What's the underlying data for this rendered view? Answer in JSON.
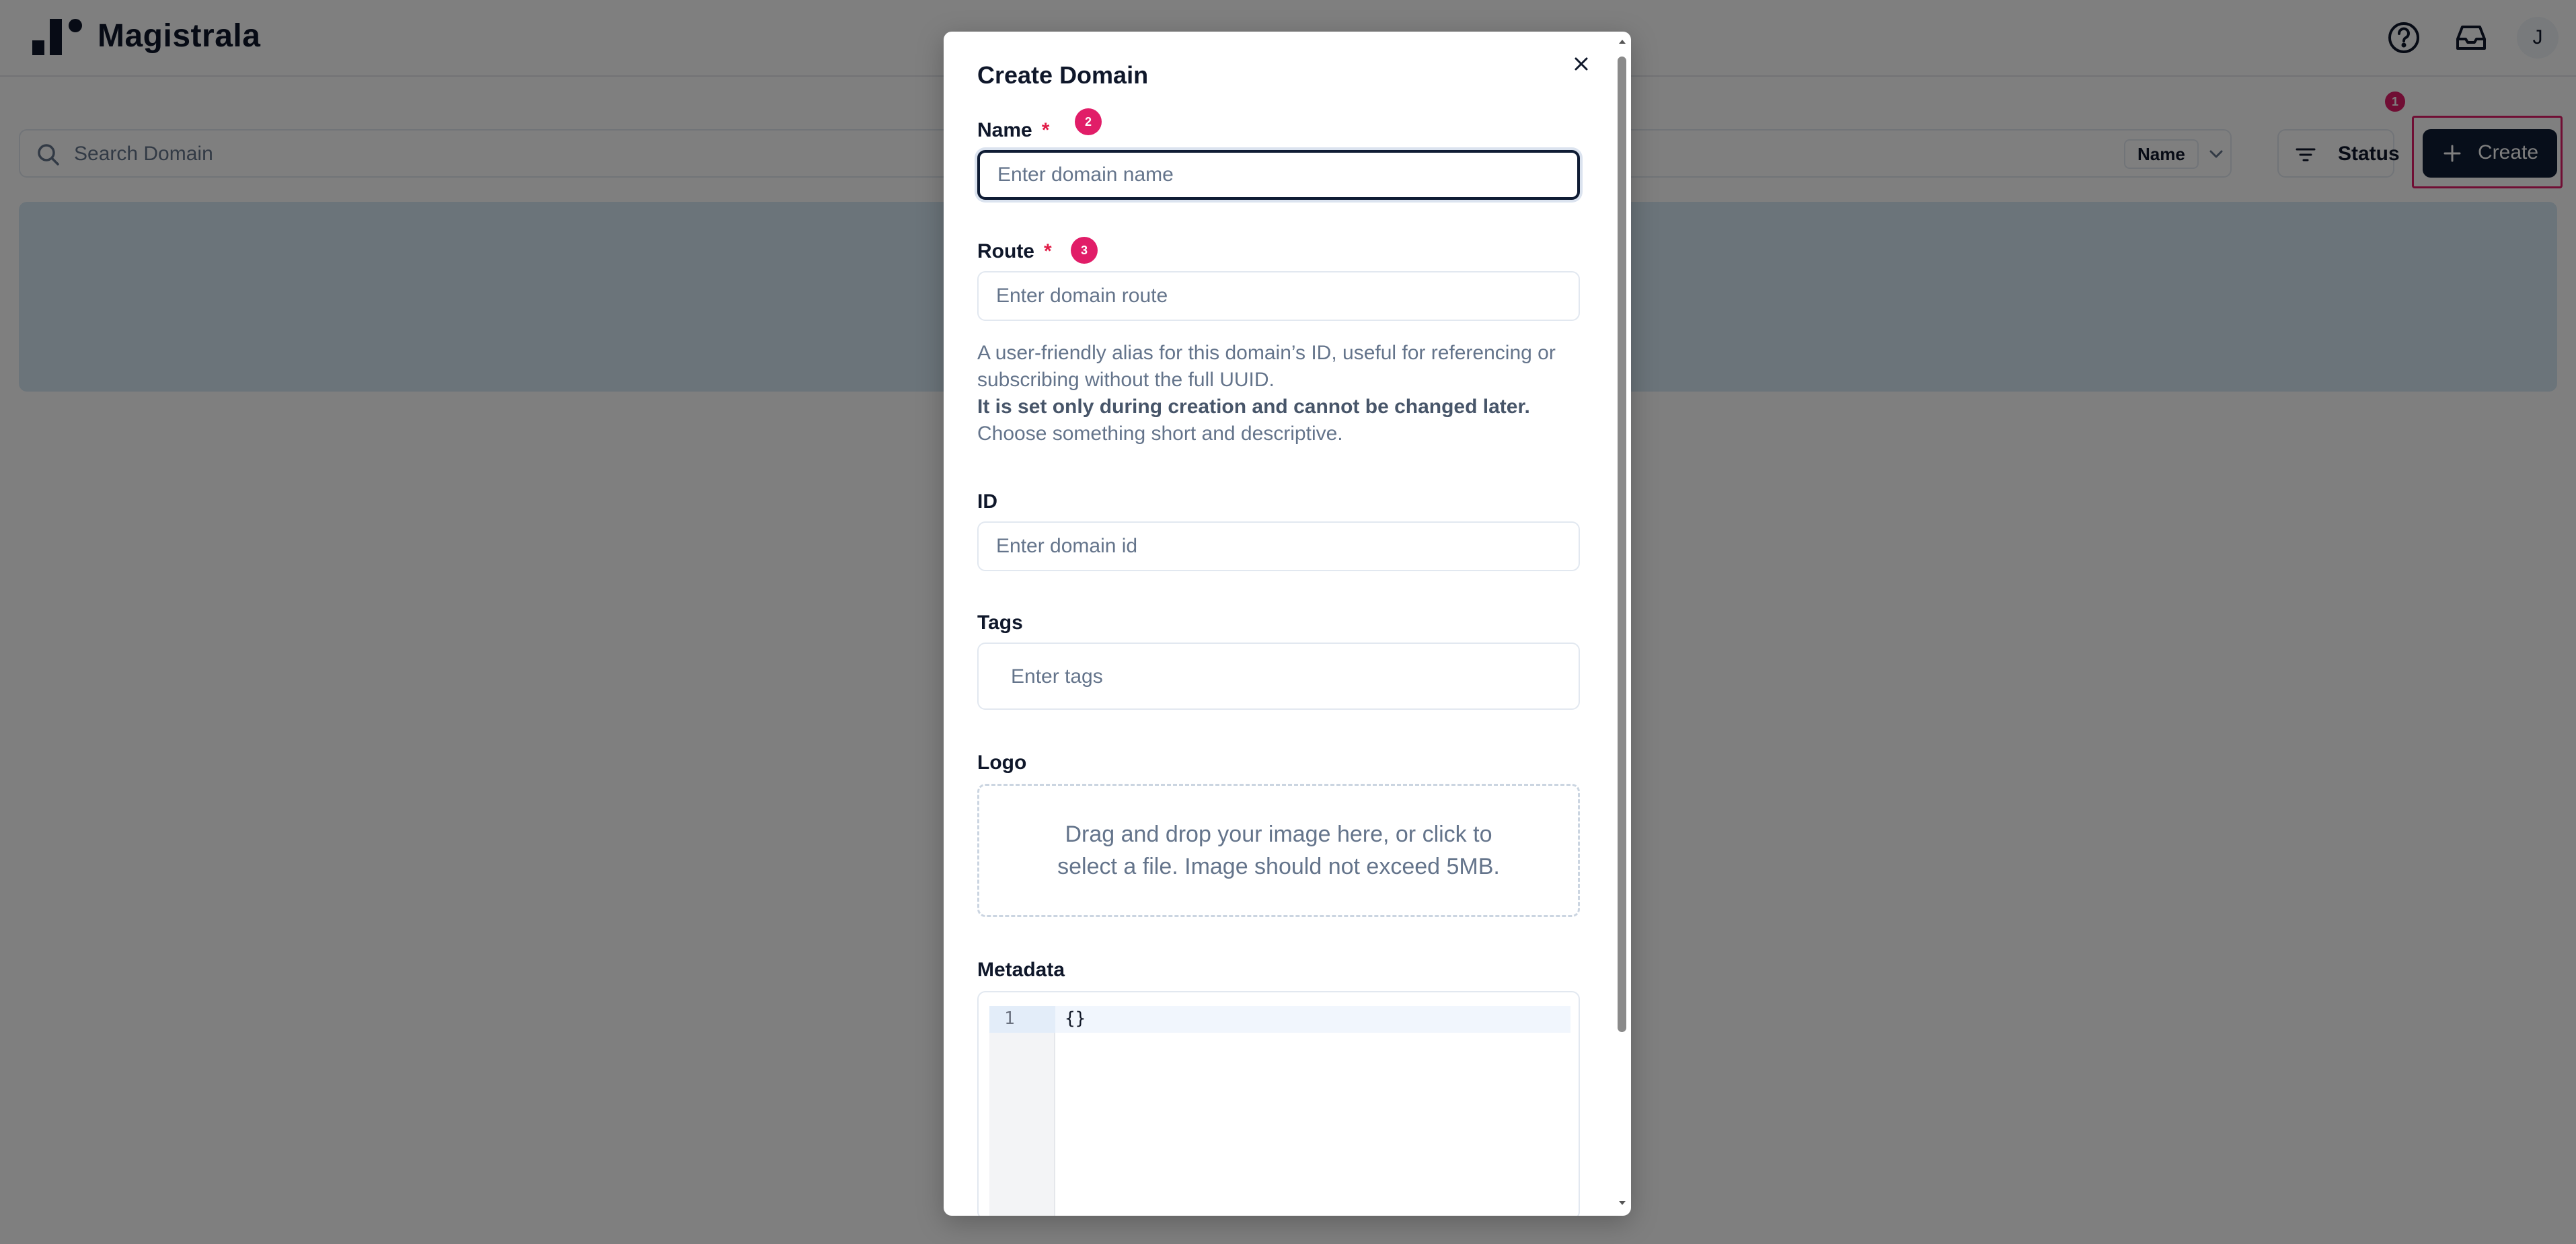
{
  "app": {
    "brand": "Magistrala",
    "user_initial": "J"
  },
  "toolbar": {
    "search_placeholder": "Search Domain",
    "sort_field": "Name",
    "status_label": "Status",
    "create_label": "Create"
  },
  "annotations": {
    "badge_1": "1",
    "badge_2": "2",
    "badge_3": "3"
  },
  "modal": {
    "title": "Create Domain",
    "name": {
      "label": "Name",
      "required_mark": "*",
      "placeholder": "Enter domain name",
      "value": ""
    },
    "route": {
      "label": "Route",
      "required_mark": "*",
      "placeholder": "Enter domain route",
      "value": ""
    },
    "help": {
      "line1": "A user-friendly alias for this domain’s ID, useful for referencing or subscribing without the full UUID.",
      "bold": "It is set only during creation and cannot be changed later.",
      "rest": " Choose something short and descriptive."
    },
    "id": {
      "label": "ID",
      "placeholder": "Enter domain id",
      "value": ""
    },
    "tags": {
      "label": "Tags",
      "placeholder": "Enter tags"
    },
    "logo": {
      "label": "Logo",
      "dropzone_text": "Drag and drop your image here, or click to select a file. Image should not exceed 5MB."
    },
    "metadata": {
      "label": "Metadata",
      "line_number": "1",
      "code": "{}"
    }
  },
  "colors": {
    "primary": "#0f1c34",
    "annotation": "#e11d68",
    "required": "#e11d48",
    "banner": "#d7e8f5"
  },
  "icons": [
    "logo-icon",
    "help-circle-icon",
    "inbox-icon",
    "search-icon",
    "chevron-down-icon",
    "filter-icon",
    "plus-icon",
    "close-icon"
  ]
}
